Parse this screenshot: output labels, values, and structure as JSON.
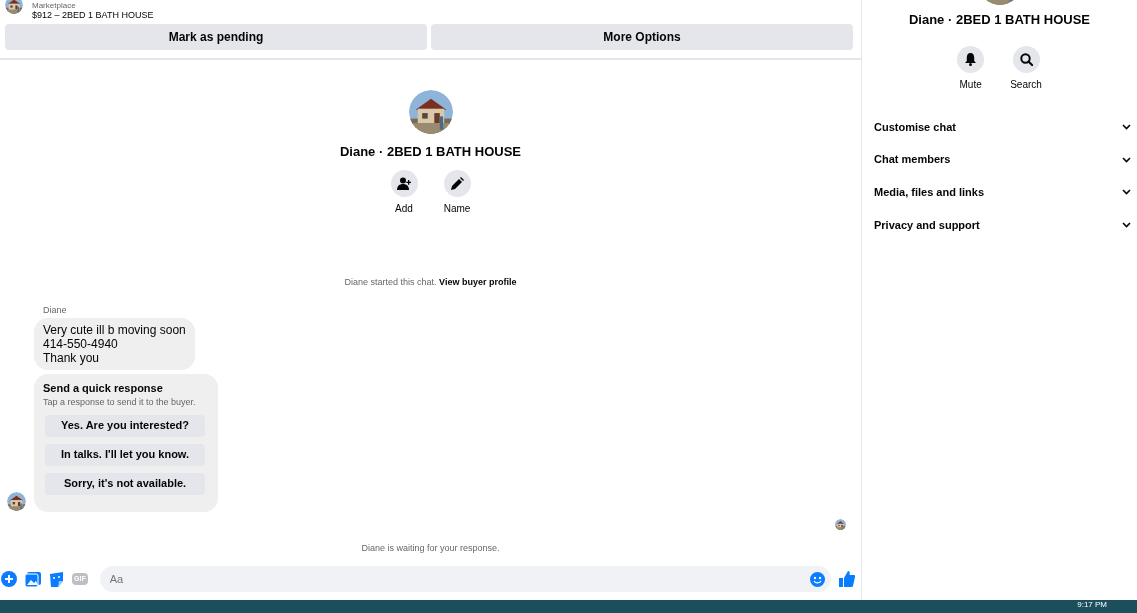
{
  "listing": {
    "source": "Marketplace",
    "title": "$912 – 2BED 1 BATH HOUSE"
  },
  "header_buttons": [
    "Mark as pending",
    "More Options"
  ],
  "chat_profile": {
    "title": "Diane · 2BED 1 BATH HOUSE",
    "actions": [
      {
        "label": "Add",
        "kind": "add-person"
      },
      {
        "label": "Name",
        "kind": "pencil"
      }
    ]
  },
  "start_notice": {
    "text": "Diane started this chat.",
    "link": "View buyer profile"
  },
  "message": {
    "sender": "Diane",
    "lines": [
      "Very cute ill b moving soon",
      "414-550-4940",
      "Thank you"
    ]
  },
  "quick_response": {
    "title": "Send a quick response",
    "subtitle": "Tap a response to send it to the buyer.",
    "options": [
      "Yes. Are you interested?",
      "In talks. I'll let you know.",
      "Sorry, it's not available."
    ]
  },
  "waiting_notice": "Diane is waiting for your response.",
  "composer": {
    "placeholder": "Aa",
    "gif_label": "GIF"
  },
  "sidebar": {
    "title": "Diane · 2BED 1 BATH HOUSE",
    "actions": [
      {
        "label": "Mute",
        "kind": "bell"
      },
      {
        "label": "Search",
        "kind": "search"
      }
    ],
    "sections": [
      {
        "label": "Customise chat",
        "expanded": false
      },
      {
        "label": "Chat members",
        "expanded": false
      },
      {
        "label": "Media, files and links",
        "expanded": false
      },
      {
        "label": "Privacy and support",
        "expanded": false
      }
    ]
  },
  "taskbar": {
    "time": "9:17 PM"
  }
}
